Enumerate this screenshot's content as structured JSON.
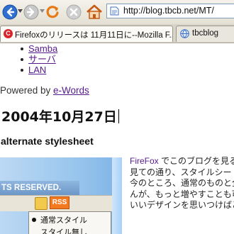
{
  "browser": {
    "url": "http://blog.tbcb.net/MT/",
    "tabs": [
      {
        "label": "Firefoxのリリースは 11月11日に--Mozilla F...",
        "active": true
      },
      {
        "label": "tbcblog",
        "active": false
      }
    ],
    "icons": [
      "back-arrow-icon",
      "forward-arrow-icon",
      "reload-icon",
      "stop-icon",
      "home-icon"
    ]
  },
  "page": {
    "links": [
      "Samba",
      "サーバ",
      "LAN"
    ],
    "powered_prefix": "Powered by ",
    "powered_link": "e-Words",
    "date": "2004年10月27日",
    "post_title": "alternate stylesheet",
    "screenshot": {
      "band_text": "TS RESERVED.",
      "rss_label": "RSS",
      "menu": [
        "通常スタイル",
        "スタイル無し"
      ]
    },
    "paragraph_lead": "FireFox",
    "paragraph_lines": [
      "でこのブログを見る",
      "見ての通り、スタイルシートを",
      "今のところ、通常のものと全く",
      "んが、もっと増やすことも可能",
      "いいデザインを思いつけばど"
    ]
  },
  "colors": {
    "link": "#551a8b",
    "back": "#2f6fd0",
    "reload": "#e67a16",
    "home": "#c85a14"
  }
}
